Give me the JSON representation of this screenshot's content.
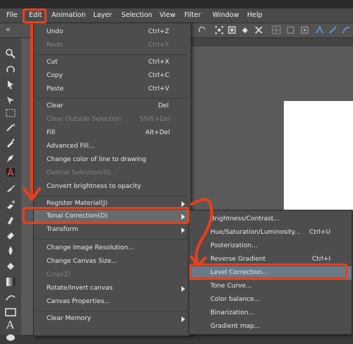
{
  "menubar": [
    "File",
    "Edit",
    "Animation",
    "Layer",
    "Selection",
    "View",
    "Filter",
    "Window",
    "Help"
  ],
  "edit_menu": {
    "items": [
      {
        "label": "Undo",
        "shortcut": "Ctrl+Z"
      },
      {
        "label": "Redo",
        "shortcut": "Ctrl+Y"
      },
      {
        "label": "Cut",
        "shortcut": "Ctrl+X"
      },
      {
        "label": "Copy",
        "shortcut": "Ctrl+C"
      },
      {
        "label": "Paste",
        "shortcut": "Ctrl+V"
      },
      {
        "label": "Clear",
        "shortcut": "Del"
      },
      {
        "label": "Clear Outside Selection",
        "shortcut": "Shift+Del"
      },
      {
        "label": "Fill",
        "shortcut": "Alt+Del"
      },
      {
        "label": "Advanced Fill..."
      },
      {
        "label": "Change color of line to drawing"
      },
      {
        "label": "Outline Selection(G)..."
      },
      {
        "label": "Convert brightness to opacity"
      },
      {
        "label": "Register Material(J)"
      },
      {
        "label": "Tonal Correction(D)"
      },
      {
        "label": "Transform"
      },
      {
        "label": "Change Image Resolution..."
      },
      {
        "label": "Change Canvas Size..."
      },
      {
        "label": "Crop(Z)"
      },
      {
        "label": "Rotate/Invert canvas"
      },
      {
        "label": "Canvas Properties..."
      },
      {
        "label": "Clear Memory"
      }
    ]
  },
  "tonal_submenu": {
    "items": [
      {
        "label": "Brightness/Contrast..."
      },
      {
        "label": "Hue/Saturation/Luminosity...",
        "shortcut": "Ctrl+U"
      },
      {
        "label": "Posterization..."
      },
      {
        "label": "Reverse Gradient",
        "shortcut": "Ctrl+I"
      },
      {
        "label": "Level Correction..."
      },
      {
        "label": "Tone Curve..."
      },
      {
        "label": "Color balance..."
      },
      {
        "label": "Binarization..."
      },
      {
        "label": "Gradient map..."
      }
    ]
  },
  "colors": {
    "annotation": "#e8401c",
    "menu_bg": "#4d4d4d",
    "disabled": "#858585",
    "highlight": "#6a6a6a"
  }
}
